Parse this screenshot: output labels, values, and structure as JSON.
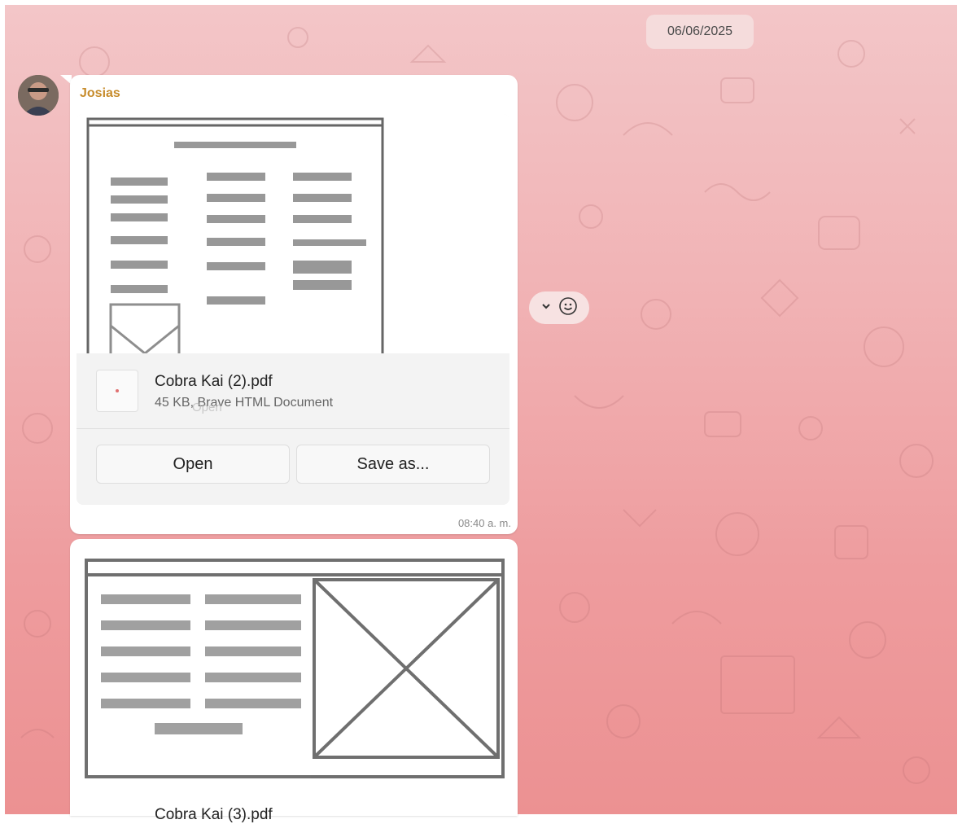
{
  "date_separator": "06/06/2025",
  "message": {
    "sender": "Josias",
    "file": {
      "name": "Cobra Kai (2).pdf",
      "meta": "45 KB, Brave HTML Document",
      "ghost_label": "Open"
    },
    "buttons": {
      "open": "Open",
      "save_as": "Save as..."
    },
    "time": "08:40 a. m."
  },
  "message2": {
    "file_name_partial": "Cobra Kai (3).pdf"
  },
  "colors": {
    "sender": "#c78c2c",
    "bubble": "#ffffff",
    "background_top": "#f3c6c8",
    "background_bottom": "#ec9192"
  },
  "icons": {
    "chevron": "chevron-down-icon",
    "emoji": "smiley-icon",
    "file": "file-icon"
  }
}
